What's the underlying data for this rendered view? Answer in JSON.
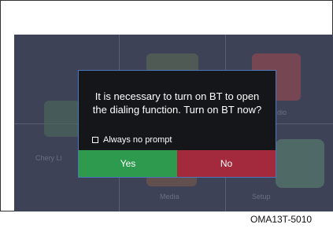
{
  "dialog": {
    "message_line1": "It is necessary to turn on BT to open",
    "message_line2": "the dialing function. Turn on BT now?",
    "checkbox_label": "Always no prompt",
    "checkbox_checked": false,
    "yes_label": "Yes",
    "no_label": "No"
  },
  "background_tiles": {
    "phone_label": "Chery Li",
    "radio_label": "dio",
    "media_label": "Media",
    "setup_label": "Setup"
  },
  "caption": "OMA13T-5010",
  "colors": {
    "yes_button": "#2e9a4e",
    "no_button": "#a3293c",
    "dialog_bg": "#141619",
    "dialog_border": "#4a78b8"
  }
}
